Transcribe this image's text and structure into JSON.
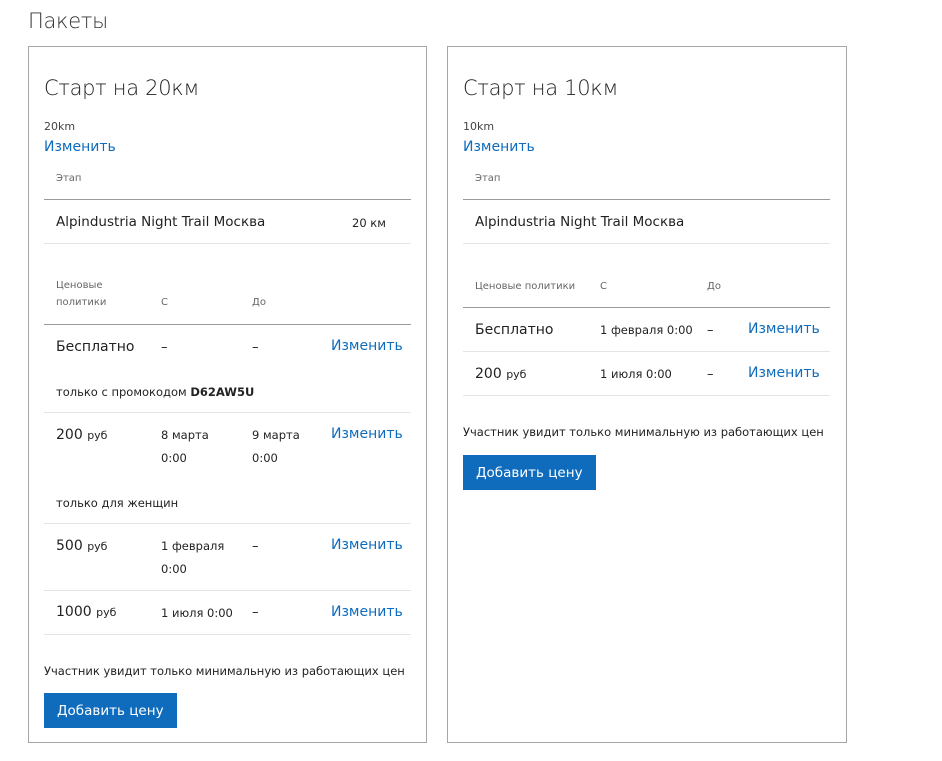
{
  "page": {
    "title": "Пакеты"
  },
  "packages": [
    {
      "title": "Старт на 20км",
      "subtitle": "20km",
      "edit_label": "Изменить",
      "stage_header": "Этап",
      "stage": {
        "name": "Alpindustria Night Trail Москва",
        "distance": "20 км"
      },
      "price_headers": {
        "policy": "Ценовые\nполитики",
        "from": "С",
        "to": "До"
      },
      "prices": [
        {
          "amount": "Бесплатно",
          "unit": "",
          "from": "–",
          "to": "–",
          "edit": "Изменить",
          "condition_prefix": "только с промокодом",
          "condition_code": "D62AW5U"
        },
        {
          "amount": "200",
          "unit": "руб",
          "from": "8 марта\n0:00",
          "to": "9 марта\n0:00",
          "edit": "Изменить",
          "condition_prefix": "только для женщин",
          "condition_code": ""
        },
        {
          "amount": "500",
          "unit": "руб",
          "from": "1 февраля\n0:00",
          "to": "–",
          "edit": "Изменить"
        },
        {
          "amount": "1000",
          "unit": "руб",
          "from": "1 июля 0:00",
          "to": "–",
          "edit": "Изменить"
        }
      ],
      "note": "Участник увидит только минимальную из работающих цен",
      "add_button": "Добавить цену"
    },
    {
      "title": "Старт на 10км",
      "subtitle": "10km",
      "edit_label": "Изменить",
      "stage_header": "Этап",
      "stage": {
        "name": "Alpindustria Night Trail Москва",
        "distance": ""
      },
      "price_headers": {
        "policy": "Ценовые политики",
        "from": "С",
        "to": "До"
      },
      "prices": [
        {
          "amount": "Бесплатно",
          "unit": "",
          "from": "1 февраля 0:00",
          "to": "–",
          "edit": "Изменить"
        },
        {
          "amount": "200",
          "unit": "руб",
          "from": "1 июля 0:00",
          "to": "–",
          "edit": "Изменить"
        }
      ],
      "note": "Участник увидит только минимальную из работающих цен",
      "add_button": "Добавить цену"
    }
  ],
  "colors": {
    "accent": "#0f6cbd",
    "border": "#a6a6a6"
  }
}
